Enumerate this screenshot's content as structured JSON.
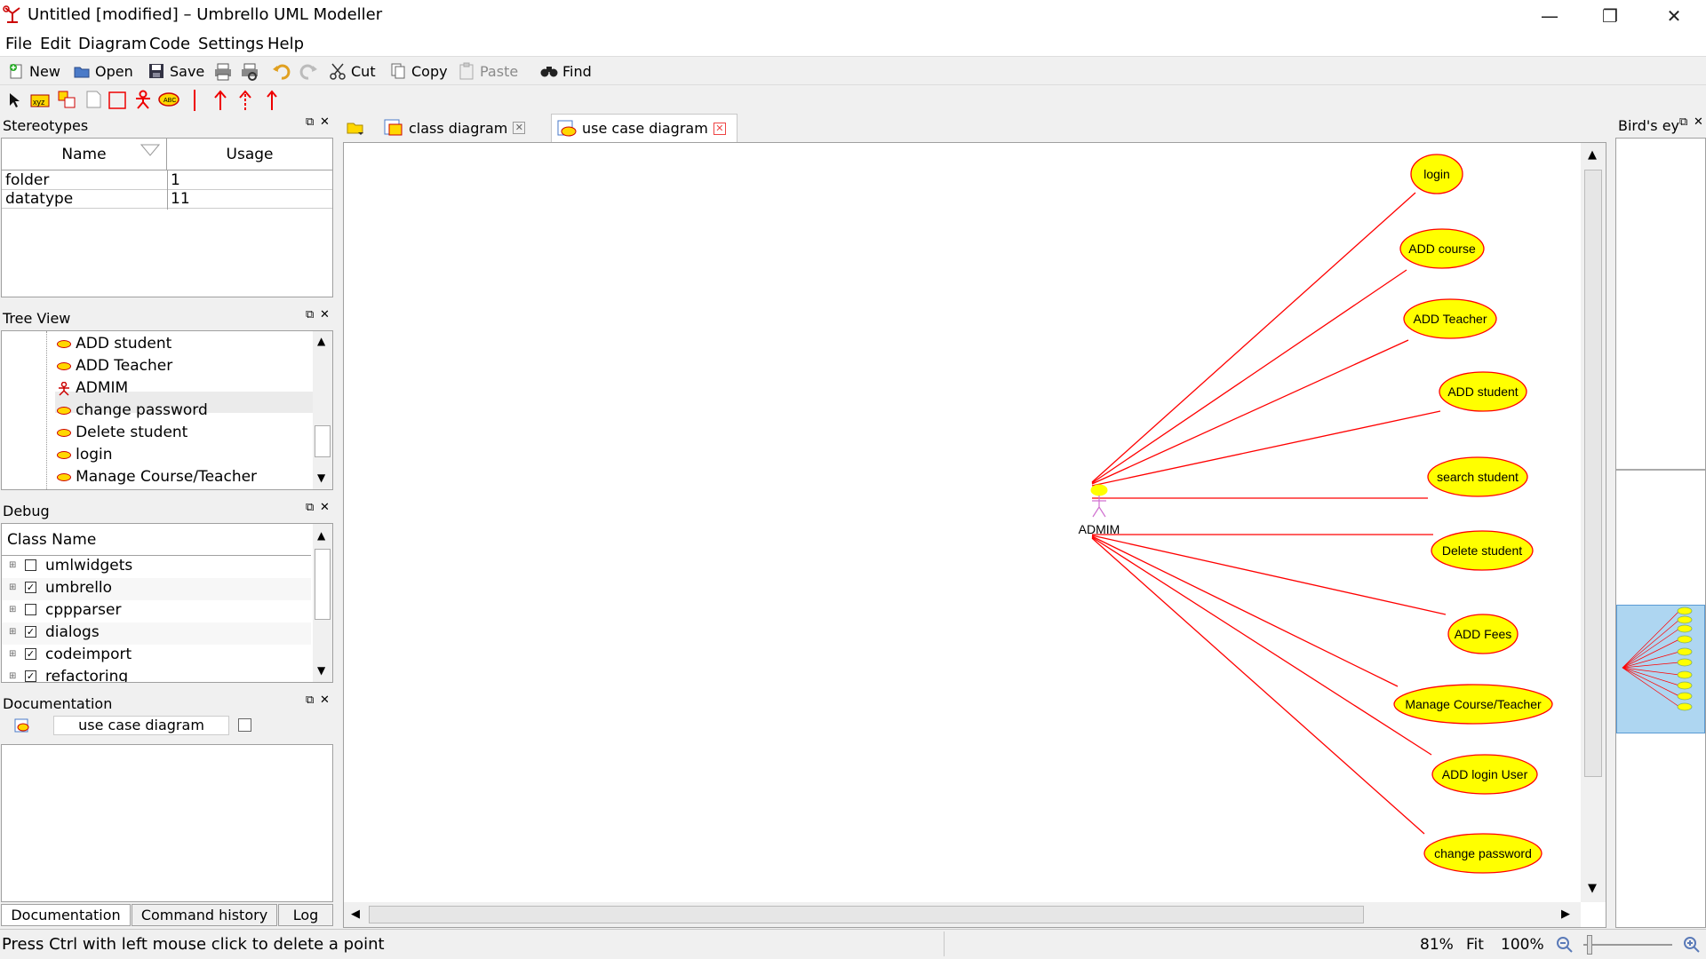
{
  "window": {
    "title": "Untitled [modified] – Umbrello UML Modeller",
    "minimize_glyph": "—",
    "restore_glyph": "❐",
    "close_glyph": "✕"
  },
  "menu": [
    "File",
    "Edit",
    "Diagram",
    "Code",
    "Settings",
    "Help"
  ],
  "toolbar": {
    "new": "New",
    "open": "Open",
    "save": "Save",
    "cut": "Cut",
    "copy": "Copy",
    "paste": "Paste",
    "find": "Find"
  },
  "stereotypes": {
    "title": "Stereotypes",
    "columns": [
      "Name",
      "Usage"
    ],
    "rows": [
      {
        "name": "folder",
        "usage": "1"
      },
      {
        "name": "datatype",
        "usage": "11"
      }
    ]
  },
  "tree_view": {
    "title": "Tree View",
    "items": [
      {
        "label": "ADD student",
        "icon": "usecase-icon"
      },
      {
        "label": "ADD Teacher",
        "icon": "usecase-icon"
      },
      {
        "label": "ADMIM",
        "icon": "actor-icon"
      },
      {
        "label": "change password",
        "icon": "usecase-icon"
      },
      {
        "label": "Delete student",
        "icon": "usecase-icon"
      },
      {
        "label": "login",
        "icon": "usecase-icon"
      },
      {
        "label": "Manage Course/Teacher",
        "icon": "usecase-icon"
      }
    ]
  },
  "debug": {
    "title": "Debug",
    "column": "Class Name",
    "items": [
      {
        "label": "umlwidgets",
        "checked": false
      },
      {
        "label": "umbrello",
        "checked": true
      },
      {
        "label": "cppparser",
        "checked": false
      },
      {
        "label": "dialogs",
        "checked": true
      },
      {
        "label": "codeimport",
        "checked": true
      },
      {
        "label": "refactoring",
        "checked": true
      }
    ]
  },
  "documentation": {
    "title": "Documentation",
    "diagram_name": "use case diagram"
  },
  "bottom_tabs": [
    "Documentation",
    "Command history",
    "Log"
  ],
  "tabs": [
    {
      "label": "class diagram",
      "active": false
    },
    {
      "label": "use case diagram",
      "active": true
    }
  ],
  "birds_eye": {
    "title": "Bird's ey"
  },
  "diagram": {
    "actor": "ADMIM",
    "use_cases": [
      "login",
      "ADD course",
      "ADD Teacher",
      "ADD student",
      "search student",
      "Delete student",
      "ADD Fees",
      "Manage Course/Teacher",
      "ADD login User",
      "change password"
    ],
    "fill_color": "#ffff00",
    "line_color": "#ff0000"
  },
  "status": {
    "message": "Press Ctrl with left mouse click to delete a point",
    "zoom": "81%",
    "fit": "Fit",
    "hundred": "100%"
  }
}
